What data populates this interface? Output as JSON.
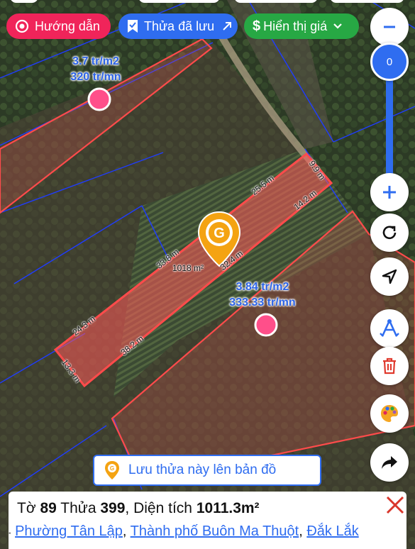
{
  "toolbar": {
    "guide_label": "Hướng dẫn",
    "saved_label": "Thửa đã lưu",
    "price_label": "Hiển thị giá"
  },
  "zoom": {
    "level": "0"
  },
  "plots": {
    "top": {
      "price_m2": "3.7 tr/m2",
      "price_total": "320 tr/mn"
    },
    "right": {
      "price_m2": "3.84 tr/m2",
      "price_total": "333.33 tr/mn"
    }
  },
  "selected_plot": {
    "area_label": "1018 m²",
    "dimensions": {
      "d1": "9.9 m",
      "d2": "25.5 m",
      "d3": "14.2 m",
      "d4": "33.8 m",
      "d5": "32.4 m",
      "d6": "24.3 m",
      "d7": "38.2 m",
      "d8": "13.3 m"
    }
  },
  "save_button": {
    "label": "Lưu thửa này lên bản đồ"
  },
  "info": {
    "sheet_prefix": "Tờ",
    "sheet_no": "89",
    "plot_prefix": "Thửa",
    "plot_no": "399",
    "area_prefix": ", Diện tích",
    "area_value": "1011.3m²",
    "ward": "Phường Tân Lập",
    "city": "Thành phố Buôn Ma Thuột",
    "province": "Đắk Lắk"
  },
  "colors": {
    "plot_outline": "#ff4b4b",
    "grid_line": "#1f3cff",
    "guide_pill": "#f0245a",
    "saved_pill": "#2f6df0",
    "price_pill": "#27a844",
    "accent_blue": "#2f6df0",
    "marker_orange": "#f4a312"
  }
}
